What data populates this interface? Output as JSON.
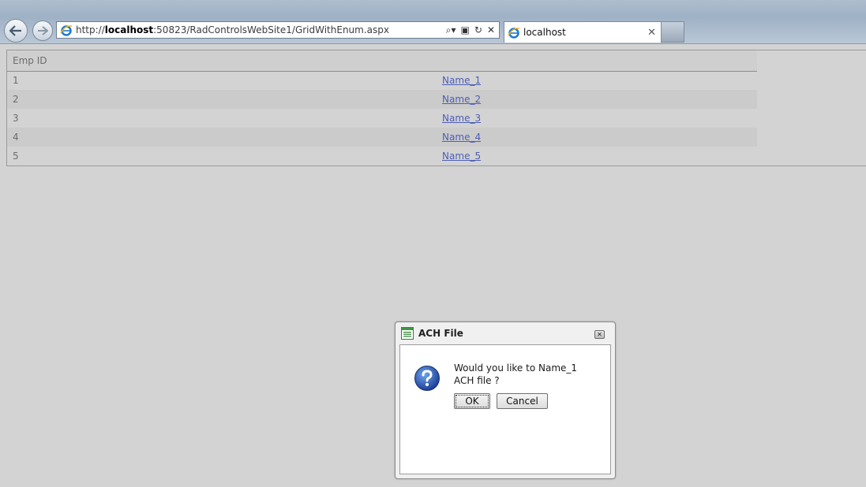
{
  "browser": {
    "url_prefix": "http://",
    "url_host": "localhost",
    "url_rest": ":50823/RadControlsWebSite1/GridWithEnum.aspx",
    "tab_title": "localhost",
    "tools": {
      "search": "⌕▾",
      "compat": "▣",
      "refresh": "↻",
      "stop": "✕"
    },
    "tab_close": "✕"
  },
  "grid": {
    "header": "Emp ID",
    "rows": [
      {
        "id": "1",
        "name": "Name_1"
      },
      {
        "id": "2",
        "name": "Name_2"
      },
      {
        "id": "3",
        "name": "Name_3"
      },
      {
        "id": "4",
        "name": "Name_4"
      },
      {
        "id": "5",
        "name": "Name_5"
      }
    ],
    "link_color": "#4d5eb6"
  },
  "dialog": {
    "title": "ACH File",
    "close": "✕",
    "message": "Would you like to Name_1 ACH file ?",
    "ok_label": "OK",
    "cancel_label": "Cancel"
  }
}
